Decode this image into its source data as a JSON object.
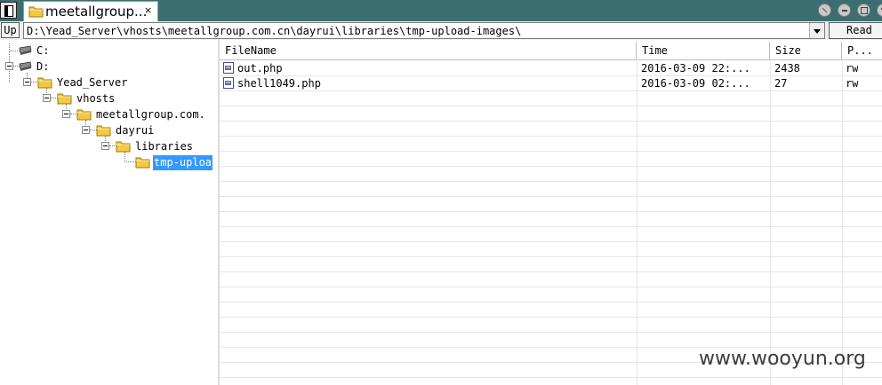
{
  "tab": {
    "title": "meetallgroup...",
    "close": "×"
  },
  "toolbar": {
    "up_label": "Up",
    "path": "D:\\Yead_Server\\vhosts\\meetallgroup.com.cn\\dayrui\\libraries\\tmp-upload-images\\",
    "read_label": "Read"
  },
  "tree": {
    "drives": [
      {
        "label": "C:"
      },
      {
        "label": "D:"
      }
    ],
    "folders": [
      {
        "label": "Yead_Server"
      },
      {
        "label": "vhosts"
      },
      {
        "label": "meetallgroup.com."
      },
      {
        "label": "dayrui"
      },
      {
        "label": "libraries"
      },
      {
        "label": "tmp-uploa"
      }
    ],
    "selected": "tmp-uploa"
  },
  "grid": {
    "columns": [
      "FileName",
      "Time",
      "Size",
      "P..."
    ],
    "rows": [
      {
        "name": "out.php",
        "time": "2016-03-09 22:...",
        "size": "2438",
        "perm": "rw"
      },
      {
        "name": "shell1049.php",
        "time": "2016-03-09 02:...",
        "size": "27",
        "perm": "rw"
      }
    ]
  },
  "watermark": "www.wooyun.org",
  "colors": {
    "titlebar": "#3a6e70",
    "selection": "#3399ff",
    "folder": "#f5c842"
  },
  "icons": [
    "app-icon",
    "folder-icon",
    "drive-icon",
    "php-file-icon",
    "close-icon",
    "dropdown-arrow-icon"
  ]
}
